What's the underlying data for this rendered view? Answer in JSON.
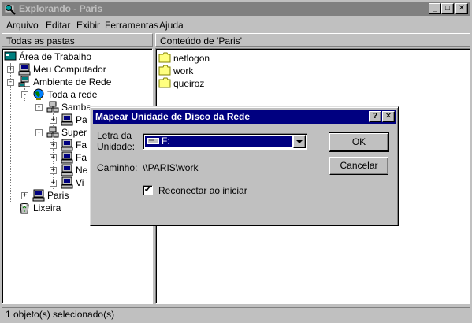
{
  "window": {
    "title": "Explorando - Paris",
    "minimize": "_",
    "maximize": "□",
    "close": "✕"
  },
  "menu": [
    {
      "label": "Arquivo"
    },
    {
      "label": "Editar"
    },
    {
      "label": "Exibir"
    },
    {
      "label": "Ferramentas"
    },
    {
      "label": "Ajuda"
    }
  ],
  "left_pane": {
    "header": "Todas as pastas",
    "tree": [
      {
        "label": "Área de Trabalho",
        "icon": "desktop-icon"
      },
      {
        "label": "Meu Computador",
        "icon": "computer-icon",
        "expander": "+"
      },
      {
        "label": "Ambiente de Rede",
        "icon": "network-icon",
        "expander": "-"
      },
      {
        "label": "Toda a rede",
        "icon": "globe-icon",
        "expander": "-"
      },
      {
        "label": "Samba",
        "icon": "workgroup-icon",
        "expander": "-"
      },
      {
        "label": "Pa",
        "icon": "computer-icon",
        "expander": "+"
      },
      {
        "label": "Super",
        "icon": "workgroup-icon",
        "expander": "-"
      },
      {
        "label": "Fa",
        "icon": "computer-icon",
        "expander": "+"
      },
      {
        "label": "Fa",
        "icon": "computer-icon",
        "expander": "+"
      },
      {
        "label": "Ne",
        "icon": "computer-icon",
        "expander": "+"
      },
      {
        "label": "Vi",
        "icon": "computer-icon",
        "expander": "+"
      },
      {
        "label": "Paris",
        "icon": "computer-icon",
        "expander": "+"
      },
      {
        "label": "Lixeira",
        "icon": "recycle-bin-icon"
      }
    ]
  },
  "right_pane": {
    "header": "Conteúdo de 'Paris'",
    "items": [
      {
        "label": "netlogon",
        "icon": "folder-icon"
      },
      {
        "label": "work",
        "icon": "folder-icon"
      },
      {
        "label": "queiroz",
        "icon": "folder-icon"
      }
    ]
  },
  "status": {
    "text": "1 objeto(s) selecionado(s)"
  },
  "dialog": {
    "title": "Mapear Unidade de Disco da Rede",
    "help_button": "?",
    "close_button": "✕",
    "drive_label_line1": "Letra da",
    "drive_label_line2": "Unidade:",
    "drive_value": "F:",
    "path_label": "Caminho:",
    "path_value": "\\\\PARIS\\work",
    "reconnect_label": "Reconectar ao iniciar",
    "reconnect_checked": true,
    "check_mark": "✔",
    "ok_label": "OK",
    "cancel_label": "Cancelar"
  },
  "colors": {
    "face": "#c0c0c0",
    "active_title": "#000080",
    "inactive_title": "#808080",
    "window_bg": "#ffffff"
  }
}
